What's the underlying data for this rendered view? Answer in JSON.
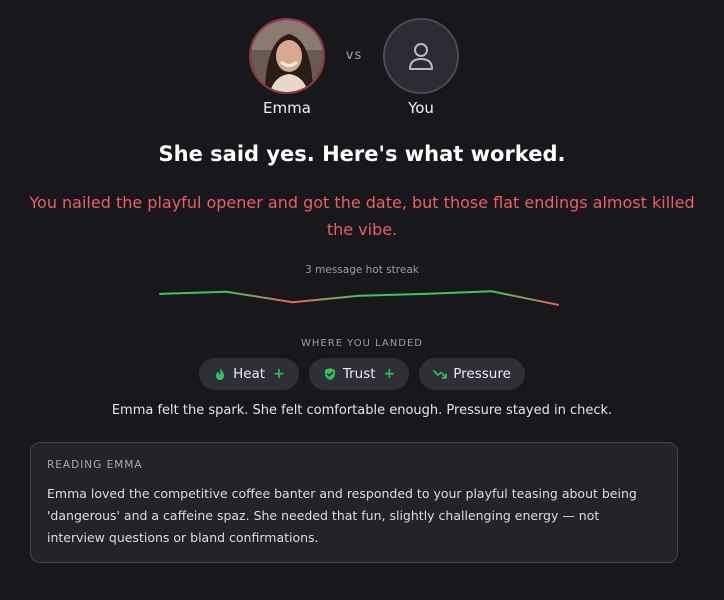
{
  "header": {
    "left_name": "Emma",
    "right_name": "You",
    "vs_label": "vs",
    "left_avatar_icon": "profile-photo",
    "right_avatar_icon": "user-icon"
  },
  "headline": "She said yes. Here's what worked.",
  "summary": "You nailed the playful opener and got the date, but those flat endings almost killed the vibe.",
  "streak": {
    "label": "3 message hot streak",
    "points": [
      0.62,
      0.7,
      0.3,
      0.55,
      0.62,
      0.72,
      0.2
    ],
    "colors": {
      "hot": "#37c95a",
      "cold": "#ef5f5f"
    }
  },
  "landed": {
    "label": "WHERE YOU LANDED",
    "chips": [
      {
        "label": "Heat",
        "icon": "flame-icon",
        "delta": "+"
      },
      {
        "label": "Trust",
        "icon": "shield-check-icon",
        "delta": "+"
      },
      {
        "label": "Pressure",
        "icon": "trend-down-icon",
        "delta": ""
      }
    ]
  },
  "verdict": "Emma felt the spark. She felt comfortable enough. Pressure stayed in check.",
  "reading": {
    "title": "READING EMMA",
    "text": "Emma loved the competitive coffee banter and responded to your playful teasing about being 'dangerous' and a caffeine spaz. She needed that fun, slightly challenging energy — not interview questions or bland confirmations."
  },
  "colors": {
    "accent_red": "#ef5f5f",
    "accent_green": "#37c95a",
    "background": "#17171c"
  }
}
